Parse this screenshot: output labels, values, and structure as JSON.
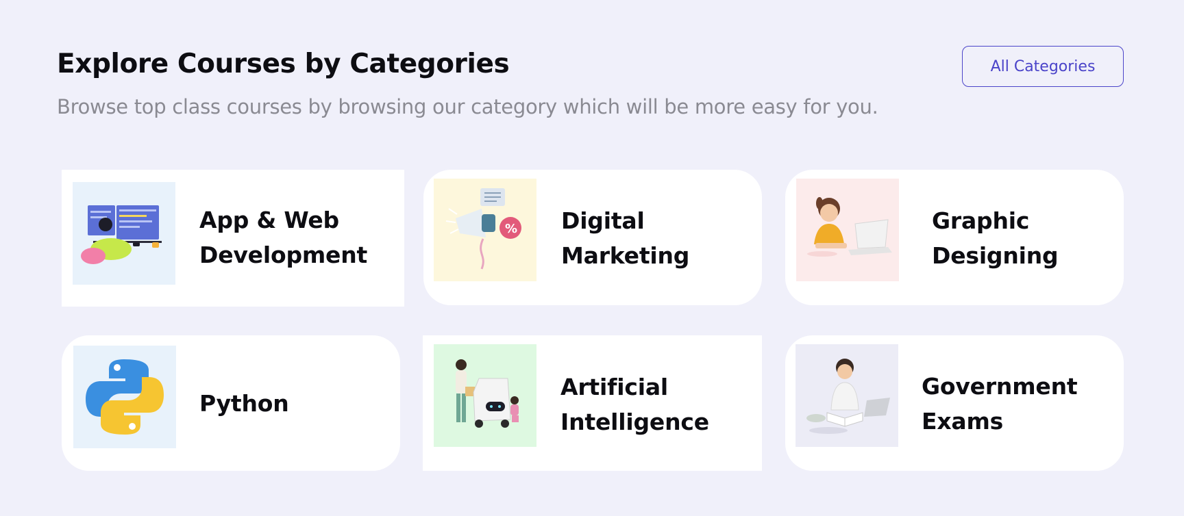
{
  "header": {
    "title": "Explore Courses by Categories",
    "subtitle": "Browse top class courses by browsing our category which will be more easy for you.",
    "all_categories_label": "All Categories"
  },
  "colors": {
    "background": "#f0f0fa",
    "accent": "#4a43c9",
    "title": "#0d0d12",
    "subtitle": "#8a8a92",
    "card": "#ffffff"
  },
  "categories": [
    {
      "line1": "App & Web",
      "line2": "Development",
      "icon": "developer-at-computer-illustration",
      "thumb_bg": "#e8f2fb"
    },
    {
      "line1": "Digital",
      "line2": "Marketing",
      "icon": "megaphone-illustration",
      "thumb_bg": "#fdf7dc"
    },
    {
      "line1": "Graphic",
      "line2": "Designing",
      "icon": "woman-at-laptop-illustration",
      "thumb_bg": "#fcebeb"
    },
    {
      "line1": "Python",
      "line2": "",
      "icon": "python-logo",
      "thumb_bg": "#e8f2fb"
    },
    {
      "line1": "Artificial",
      "line2": "Intelligence",
      "icon": "delivery-robot-illustration",
      "thumb_bg": "#def9e1"
    },
    {
      "line1": "Government",
      "line2": "Exams",
      "icon": "student-reading-illustration",
      "thumb_bg": "#ececf6"
    }
  ]
}
